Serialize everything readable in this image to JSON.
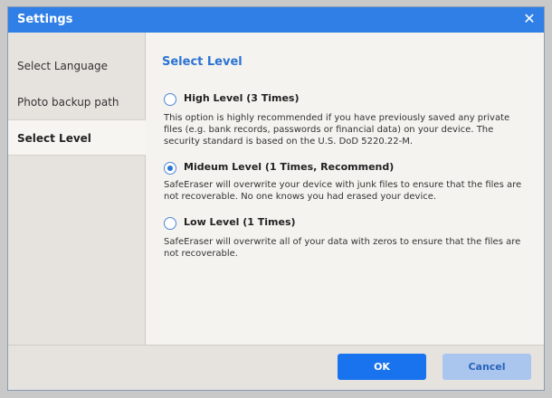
{
  "window": {
    "title": "Settings"
  },
  "sidebar": {
    "items": [
      {
        "label": "Select Language"
      },
      {
        "label": "Photo backup path"
      },
      {
        "label": "Select Level",
        "active": true
      }
    ]
  },
  "main": {
    "section_title": "Select Level",
    "options": [
      {
        "label": "High Level (3 Times)",
        "selected": false,
        "description": "This option is highly recommended if you have previously saved any private files (e.g. bank records, passwords or financial data) on your device. The security standard is based on the U.S. DoD 5220.22-M."
      },
      {
        "label": "Mideum Level (1 Times, Recommend)",
        "selected": true,
        "description": "SafeEraser will overwrite your device with junk files to ensure that the files are not recoverable. No one knows you had erased your device."
      },
      {
        "label": "Low Level (1 Times)",
        "selected": false,
        "description": "SafeEraser will overwrite all of your data with zeros to ensure that the files are not recoverable."
      }
    ]
  },
  "footer": {
    "ok_label": "OK",
    "cancel_label": "Cancel"
  },
  "colors": {
    "titlebar": "#2f7fe6",
    "accent": "#2a73d4",
    "ok_button": "#1973ee",
    "cancel_button": "#aac6ef"
  },
  "icons": {
    "close": "close-icon",
    "radio": "radio-icon"
  }
}
